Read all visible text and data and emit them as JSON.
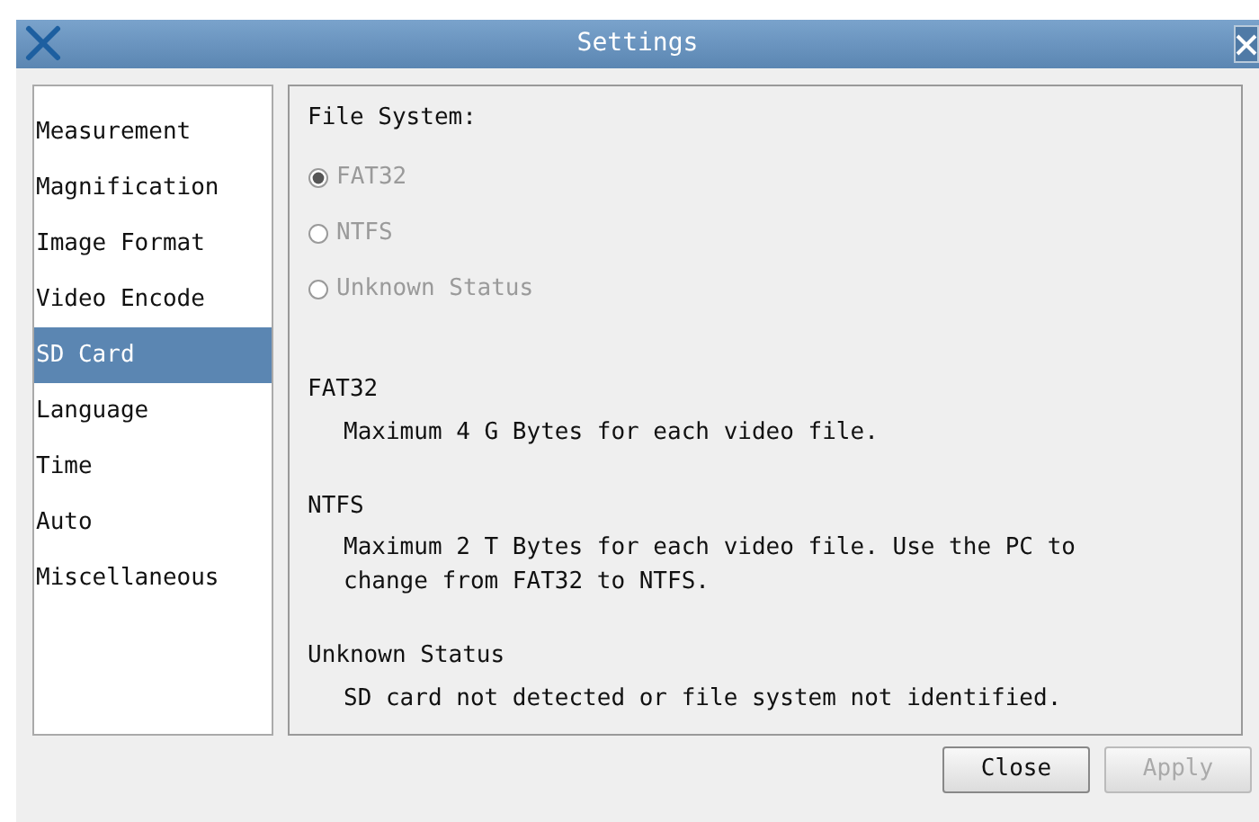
{
  "window": {
    "title": "Settings"
  },
  "sidebar": {
    "items": [
      {
        "label": "Measurement",
        "selected": false
      },
      {
        "label": "Magnification",
        "selected": false
      },
      {
        "label": "Image Format",
        "selected": false
      },
      {
        "label": "Video Encode",
        "selected": false
      },
      {
        "label": "SD Card",
        "selected": true
      },
      {
        "label": "Language",
        "selected": false
      },
      {
        "label": "Time",
        "selected": false
      },
      {
        "label": "Auto",
        "selected": false
      },
      {
        "label": "Miscellaneous",
        "selected": false
      }
    ]
  },
  "file_system": {
    "heading": "File System:",
    "options": [
      {
        "label": "FAT32",
        "selected": true,
        "disabled": true
      },
      {
        "label": "NTFS",
        "selected": false,
        "disabled": true
      },
      {
        "label": "Unknown Status",
        "selected": false,
        "disabled": true
      }
    ]
  },
  "notes": [
    {
      "title": "FAT32",
      "lines": [
        "Maximum 4 G Bytes for each video file."
      ]
    },
    {
      "title": "NTFS",
      "lines": [
        "Maximum 2 T Bytes for each video file. Use the PC to",
        "change from FAT32 to NTFS."
      ]
    },
    {
      "title": "Unknown Status",
      "lines": [
        "SD card not detected or file system not identified."
      ]
    }
  ],
  "buttons": [
    {
      "label": "Close",
      "disabled": false
    },
    {
      "label": "Apply",
      "disabled": true
    }
  ]
}
